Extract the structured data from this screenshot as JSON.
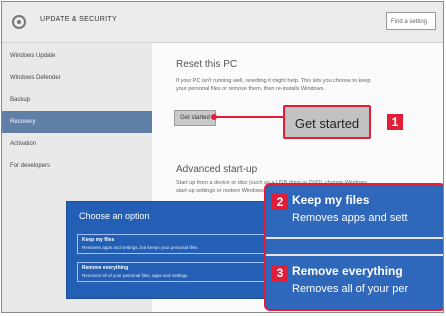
{
  "window": {
    "title": "UPDATE & SECURITY",
    "find_placeholder": "Find a setting"
  },
  "sidebar": {
    "items": [
      {
        "label": "Windows Update"
      },
      {
        "label": "Windows Defender"
      },
      {
        "label": "Backup"
      },
      {
        "label": "Recovery",
        "active": true
      },
      {
        "label": "Activation"
      },
      {
        "label": "For developers"
      }
    ]
  },
  "reset": {
    "heading": "Reset this PC",
    "description": "If your PC isn't running well, resetting it might help. This lets you choose to keep your personal files or remove them, then re-installs Windows.",
    "button_label": "Get started"
  },
  "advanced": {
    "heading": "Advanced start-up",
    "description": "Start up from a device or disc (such as a USB drive or DVD), change Windows start-up settings or restore Windows from a system image. This will restart your PC."
  },
  "callouts": {
    "1": "1",
    "2": "2",
    "3": "3"
  },
  "dialog": {
    "title": "Choose an option",
    "options": [
      {
        "title": "Keep my files",
        "description": "Removes apps and settings, but keeps your personal files."
      },
      {
        "title": "Remove everything",
        "description": "Removes all of your personal files, apps and settings."
      }
    ]
  },
  "zoom": {
    "keep_title": "Keep my files",
    "keep_desc": "Removes apps and sett",
    "remove_title": "Remove everything",
    "remove_desc": "Removes all of your per"
  },
  "colors": {
    "accent": "#e01e37",
    "dialog_blue": "#2360b5",
    "sidebar_active": "#5f7fa6"
  }
}
